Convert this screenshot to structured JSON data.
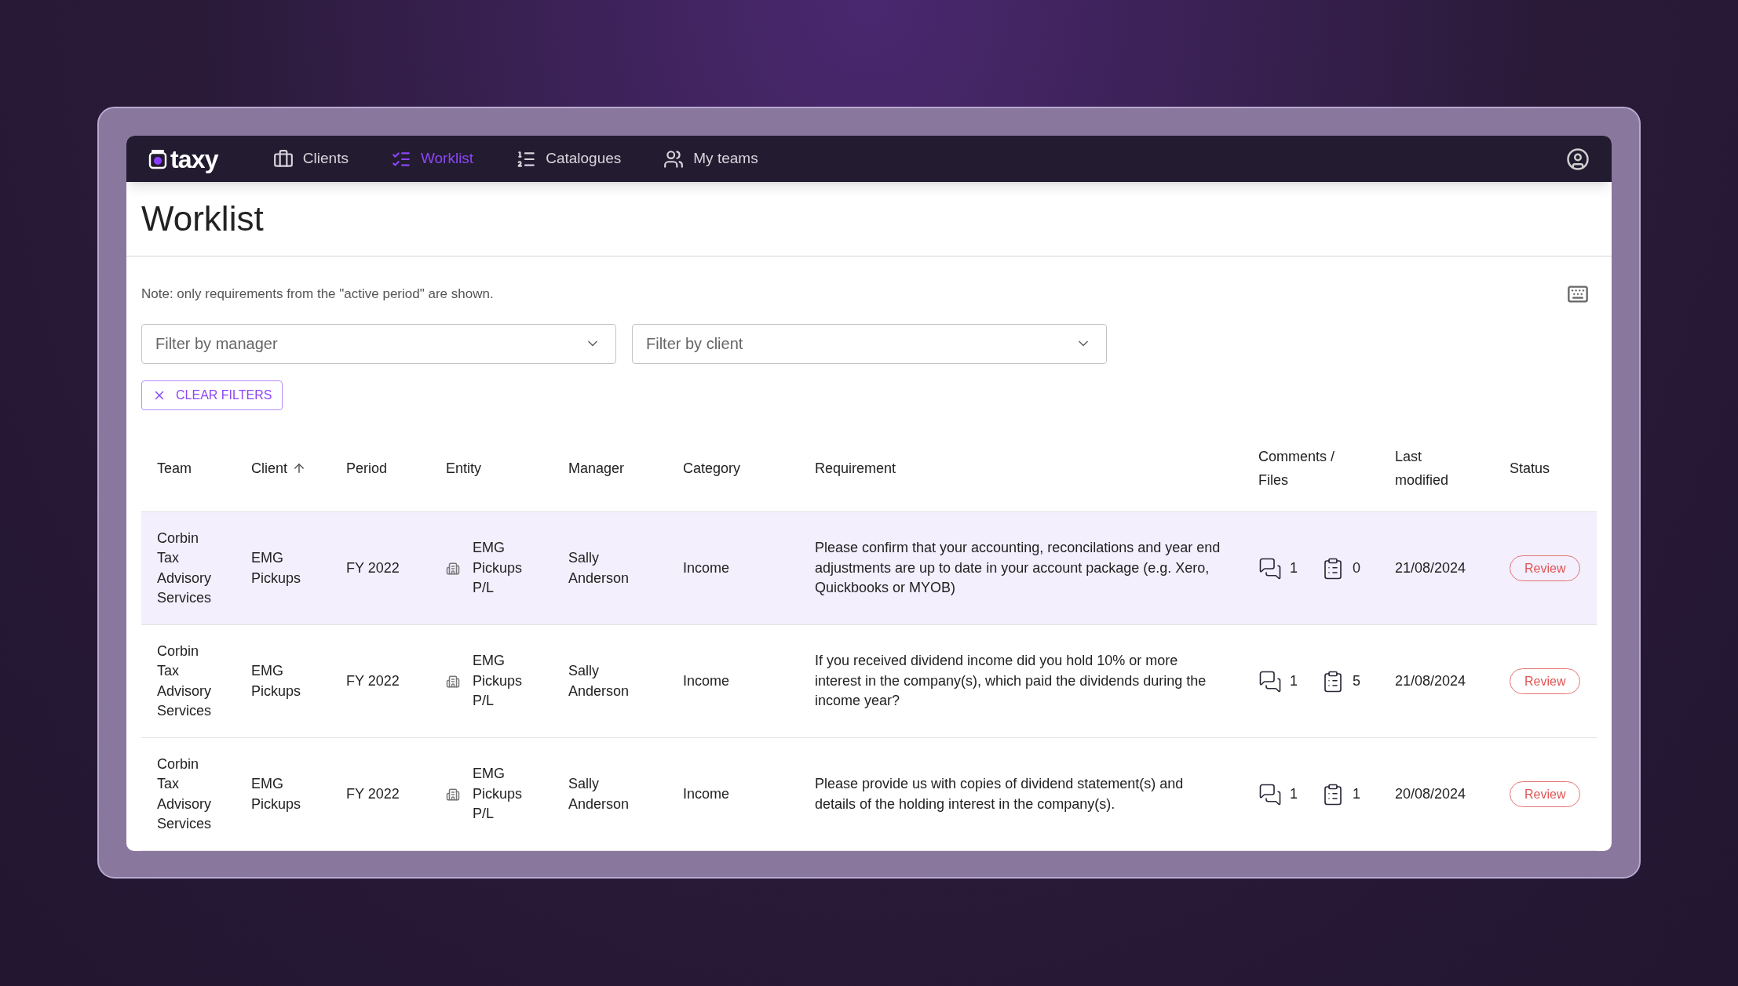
{
  "nav": {
    "logo": "taxy",
    "items": [
      {
        "label": "Clients",
        "selected": false
      },
      {
        "label": "Worklist",
        "selected": true
      },
      {
        "label": "Catalogues",
        "selected": false
      },
      {
        "label": "My teams",
        "selected": false
      }
    ]
  },
  "page": {
    "title": "Worklist",
    "note": "Note: only requirements from the \"active period\" are shown."
  },
  "filters": [
    {
      "placeholder": "Filter by manager"
    },
    {
      "placeholder": "Filter by client"
    }
  ],
  "clear_button": "CLEAR FILTERS",
  "table": {
    "columns": [
      {
        "label": "Team",
        "sorted": false
      },
      {
        "label": "Client",
        "sorted": true
      },
      {
        "label": "Period",
        "sorted": false
      },
      {
        "label": "Entity",
        "sorted": false
      },
      {
        "label": "Manager",
        "sorted": false
      },
      {
        "label": "Category",
        "sorted": false
      },
      {
        "label": "Requirement",
        "sorted": false
      },
      {
        "label": "Comments / Files",
        "sorted": false
      },
      {
        "label": "Last modified",
        "sorted": false
      },
      {
        "label": "Status",
        "sorted": false
      }
    ],
    "rows": [
      {
        "highlighted": true,
        "team": "Corbin Tax Advisory Services",
        "client": "EMG Pickups",
        "period": "FY 2022",
        "entity": "EMG Pickups P/L",
        "manager": "Sally Anderson",
        "category": "Income",
        "requirement": "Please confirm that your accounting, reconcilations and year end adjustments are up to date in your account package (e.g. Xero, Quickbooks or MYOB)",
        "comments": "1",
        "files": "0",
        "modified": "21/08/2024",
        "status": "Review"
      },
      {
        "highlighted": false,
        "team": "Corbin Tax Advisory Services",
        "client": "EMG Pickups",
        "period": "FY 2022",
        "entity": "EMG Pickups P/L",
        "manager": "Sally Anderson",
        "category": "Income",
        "requirement": "If you received dividend income did you hold 10% or more interest in the company(s), which paid the dividends during the income year?",
        "comments": "1",
        "files": "5",
        "modified": "21/08/2024",
        "status": "Review"
      },
      {
        "highlighted": false,
        "team": "Corbin Tax Advisory Services",
        "client": "EMG Pickups",
        "period": "FY 2022",
        "entity": "EMG Pickups P/L",
        "manager": "Sally Anderson",
        "category": "Income",
        "requirement": "Please provide us with copies of dividend statement(s) and details of the holding interest in the company(s).",
        "comments": "1",
        "files": "1",
        "modified": "20/08/2024",
        "status": "Review"
      }
    ]
  }
}
